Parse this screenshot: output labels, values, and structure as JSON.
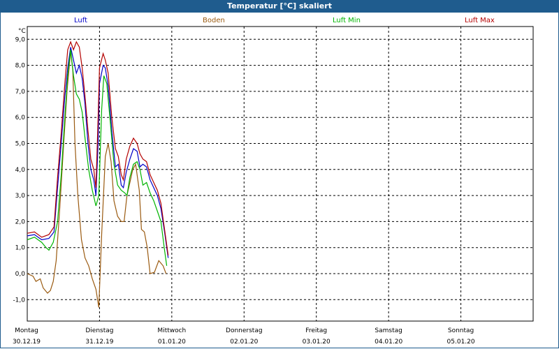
{
  "window": {
    "title": "Temperatur [°C] skaliert"
  },
  "legend": [
    {
      "name": "Luft",
      "color": "#0000c8"
    },
    {
      "name": "Boden",
      "color": "#9a5a10"
    },
    {
      "name": "Luft Min",
      "color": "#00b400"
    },
    {
      "name": "Luft Max",
      "color": "#b40000"
    }
  ],
  "chart_data": {
    "type": "line",
    "ylabel": "°C",
    "ylim": [
      -1.6,
      9.3
    ],
    "yticks": [
      -1.0,
      0.0,
      1.0,
      2.0,
      3.0,
      4.0,
      5.0,
      6.0,
      7.0,
      8.0,
      9.0
    ],
    "ytick_labels": [
      "-1,0",
      "0,0",
      "1,0",
      "2,0",
      "3,0",
      "4,0",
      "5,0",
      "6,0",
      "7,0",
      "8,0",
      "9,0"
    ],
    "xlim": [
      0,
      7
    ],
    "days": [
      {
        "x": 0,
        "name": "Montag",
        "date": "30.12.19"
      },
      {
        "x": 1,
        "name": "Dienstag",
        "date": "31.12.19"
      },
      {
        "x": 2,
        "name": "Mittwoch",
        "date": "01.01.20"
      },
      {
        "x": 3,
        "name": "Donnerstag",
        "date": "02.01.20"
      },
      {
        "x": 4,
        "name": "Freitag",
        "date": "03.01.20"
      },
      {
        "x": 5,
        "name": "Samstag",
        "date": "04.01.20"
      },
      {
        "x": 6,
        "name": "Sonntag",
        "date": "05.01.20"
      }
    ],
    "grid": true,
    "series": [
      {
        "name": "Luft",
        "color": "#0000c8",
        "points": [
          [
            0,
            1.45
          ],
          [
            0.1,
            1.5
          ],
          [
            0.2,
            1.3
          ],
          [
            0.3,
            1.35
          ],
          [
            0.37,
            1.6
          ],
          [
            0.42,
            3.3
          ],
          [
            0.47,
            5.0
          ],
          [
            0.52,
            6.8
          ],
          [
            0.56,
            7.9
          ],
          [
            0.6,
            8.7
          ],
          [
            0.64,
            8.2
          ],
          [
            0.68,
            7.7
          ],
          [
            0.72,
            8.0
          ],
          [
            0.76,
            7.5
          ],
          [
            0.8,
            6.5
          ],
          [
            0.84,
            5.0
          ],
          [
            0.88,
            4.0
          ],
          [
            0.92,
            3.6
          ],
          [
            0.95,
            3.0
          ],
          [
            0.98,
            5.0
          ],
          [
            1.0,
            7.3
          ],
          [
            1.05,
            8.0
          ],
          [
            1.08,
            7.9
          ],
          [
            1.12,
            7.2
          ],
          [
            1.17,
            5.5
          ],
          [
            1.22,
            4.1
          ],
          [
            1.26,
            4.2
          ],
          [
            1.3,
            3.4
          ],
          [
            1.33,
            3.3
          ],
          [
            1.37,
            3.9
          ],
          [
            1.42,
            4.4
          ],
          [
            1.47,
            4.8
          ],
          [
            1.52,
            4.7
          ],
          [
            1.56,
            4.1
          ],
          [
            1.6,
            4.2
          ],
          [
            1.65,
            4.1
          ],
          [
            1.7,
            3.6
          ],
          [
            1.75,
            3.3
          ],
          [
            1.8,
            3.0
          ],
          [
            1.85,
            2.5
          ],
          [
            1.9,
            1.6
          ],
          [
            1.95,
            0.6
          ]
        ]
      },
      {
        "name": "Boden",
        "color": "#9a5a10",
        "points": [
          [
            0,
            0.0
          ],
          [
            0.08,
            -0.1
          ],
          [
            0.12,
            -0.3
          ],
          [
            0.18,
            -0.2
          ],
          [
            0.22,
            -0.55
          ],
          [
            0.28,
            -0.75
          ],
          [
            0.32,
            -0.65
          ],
          [
            0.36,
            -0.3
          ],
          [
            0.4,
            0.5
          ],
          [
            0.45,
            2.5
          ],
          [
            0.5,
            4.8
          ],
          [
            0.55,
            7.0
          ],
          [
            0.6,
            8.55
          ],
          [
            0.63,
            7.8
          ],
          [
            0.66,
            5.0
          ],
          [
            0.7,
            3.0
          ],
          [
            0.75,
            1.3
          ],
          [
            0.8,
            0.6
          ],
          [
            0.85,
            0.3
          ],
          [
            0.9,
            -0.2
          ],
          [
            0.95,
            -0.6
          ],
          [
            0.99,
            -1.3
          ],
          [
            1.03,
            1.5
          ],
          [
            1.08,
            4.5
          ],
          [
            1.12,
            5.0
          ],
          [
            1.16,
            4.3
          ],
          [
            1.2,
            2.8
          ],
          [
            1.25,
            2.2
          ],
          [
            1.3,
            2.0
          ],
          [
            1.34,
            2.0
          ],
          [
            1.38,
            3.0
          ],
          [
            1.42,
            3.5
          ],
          [
            1.46,
            4.0
          ],
          [
            1.5,
            4.2
          ],
          [
            1.55,
            3.2
          ],
          [
            1.58,
            1.7
          ],
          [
            1.62,
            1.6
          ],
          [
            1.66,
            1.0
          ],
          [
            1.7,
            0.0
          ],
          [
            1.76,
            0.05
          ],
          [
            1.82,
            0.5
          ],
          [
            1.88,
            0.3
          ],
          [
            1.92,
            0.0
          ]
        ]
      },
      {
        "name": "Luft Min",
        "color": "#00b400",
        "points": [
          [
            0,
            1.3
          ],
          [
            0.1,
            1.4
          ],
          [
            0.2,
            1.2
          ],
          [
            0.26,
            1.0
          ],
          [
            0.3,
            0.9
          ],
          [
            0.36,
            1.2
          ],
          [
            0.42,
            2.0
          ],
          [
            0.47,
            3.8
          ],
          [
            0.52,
            6.0
          ],
          [
            0.56,
            7.6
          ],
          [
            0.6,
            8.6
          ],
          [
            0.64,
            7.6
          ],
          [
            0.68,
            6.9
          ],
          [
            0.72,
            6.7
          ],
          [
            0.76,
            6.2
          ],
          [
            0.8,
            5.2
          ],
          [
            0.85,
            4.0
          ],
          [
            0.9,
            3.2
          ],
          [
            0.95,
            2.6
          ],
          [
            0.99,
            3.0
          ],
          [
            1.03,
            6.3
          ],
          [
            1.06,
            7.6
          ],
          [
            1.1,
            7.3
          ],
          [
            1.15,
            5.8
          ],
          [
            1.2,
            4.2
          ],
          [
            1.25,
            3.4
          ],
          [
            1.3,
            3.2
          ],
          [
            1.35,
            3.1
          ],
          [
            1.38,
            3.0
          ],
          [
            1.42,
            3.7
          ],
          [
            1.47,
            4.2
          ],
          [
            1.52,
            4.3
          ],
          [
            1.56,
            4.0
          ],
          [
            1.6,
            3.4
          ],
          [
            1.65,
            3.5
          ],
          [
            1.7,
            3.1
          ],
          [
            1.75,
            2.8
          ],
          [
            1.8,
            2.4
          ],
          [
            1.85,
            2.0
          ],
          [
            1.9,
            0.9
          ],
          [
            1.93,
            0.3
          ]
        ]
      },
      {
        "name": "Luft Max",
        "color": "#b40000",
        "points": [
          [
            0,
            1.55
          ],
          [
            0.1,
            1.6
          ],
          [
            0.2,
            1.4
          ],
          [
            0.3,
            1.5
          ],
          [
            0.37,
            1.8
          ],
          [
            0.42,
            3.7
          ],
          [
            0.47,
            5.4
          ],
          [
            0.52,
            7.3
          ],
          [
            0.56,
            8.6
          ],
          [
            0.6,
            8.9
          ],
          [
            0.64,
            8.6
          ],
          [
            0.68,
            8.9
          ],
          [
            0.72,
            8.7
          ],
          [
            0.76,
            7.9
          ],
          [
            0.8,
            6.8
          ],
          [
            0.84,
            5.5
          ],
          [
            0.88,
            4.4
          ],
          [
            0.92,
            4.0
          ],
          [
            0.95,
            3.3
          ],
          [
            0.98,
            6.0
          ],
          [
            1.0,
            7.9
          ],
          [
            1.05,
            8.45
          ],
          [
            1.08,
            8.2
          ],
          [
            1.12,
            7.7
          ],
          [
            1.17,
            6.0
          ],
          [
            1.22,
            4.8
          ],
          [
            1.26,
            4.5
          ],
          [
            1.3,
            3.8
          ],
          [
            1.33,
            3.6
          ],
          [
            1.37,
            4.4
          ],
          [
            1.42,
            4.9
          ],
          [
            1.47,
            5.2
          ],
          [
            1.52,
            5.0
          ],
          [
            1.56,
            4.6
          ],
          [
            1.6,
            4.4
          ],
          [
            1.65,
            4.3
          ],
          [
            1.7,
            3.8
          ],
          [
            1.75,
            3.5
          ],
          [
            1.8,
            3.2
          ],
          [
            1.85,
            2.7
          ],
          [
            1.9,
            1.7
          ],
          [
            1.95,
            0.7
          ]
        ]
      }
    ]
  }
}
